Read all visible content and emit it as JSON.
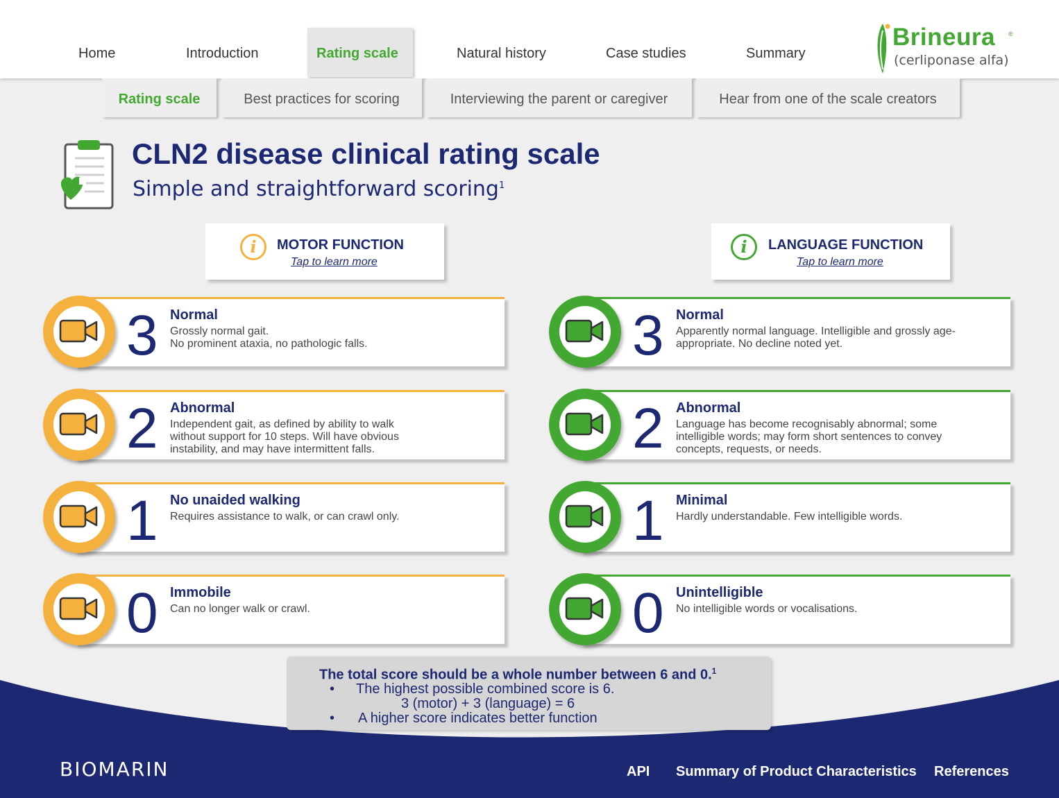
{
  "nav": {
    "items": [
      "Home",
      "Introduction",
      "Rating scale",
      "Natural history",
      "Case studies",
      "Summary"
    ],
    "active_index": 2
  },
  "logo": {
    "name": "Brineura",
    "reg": "®",
    "sub": "(cerliponase alfa)"
  },
  "subnav": {
    "items": [
      "Rating scale",
      "Best practices for scoring",
      "Interviewing the parent or caregiver",
      "Hear from one of the scale creators"
    ],
    "active_index": 0
  },
  "page": {
    "title": "CLN2 disease clinical rating scale",
    "subtitle": "Simple and straightforward scoring",
    "subtitle_ref": "1"
  },
  "motor": {
    "title": "MOTOR FUNCTION",
    "link": "Tap to learn more",
    "color": "#f5b13e",
    "rows": [
      {
        "score": "3",
        "title": "Normal",
        "desc": [
          "Grossly normal gait.",
          "No prominent ataxia, no pathologic falls."
        ]
      },
      {
        "score": "2",
        "title": "Abnormal",
        "desc": [
          "Independent gait, as defined by ability to walk",
          "without support for 10 steps. Will have obvious",
          "instability, and may have intermittent falls."
        ]
      },
      {
        "score": "1",
        "title": "No unaided walking",
        "desc": [
          "Requires assistance to walk, or can crawl only."
        ]
      },
      {
        "score": "0",
        "title": "Immobile",
        "desc": [
          "Can no longer walk or crawl."
        ]
      }
    ]
  },
  "language": {
    "title": "LANGUAGE FUNCTION",
    "link": "Tap to learn more",
    "color": "#43a832",
    "rows": [
      {
        "score": "3",
        "title": "Normal",
        "desc": [
          "Apparently normal language. Intelligible and grossly age-",
          "appropriate. No decline noted yet."
        ]
      },
      {
        "score": "2",
        "title": "Abnormal",
        "desc": [
          "Language has become recognisably abnormal; some",
          "intelligible words; may form short sentences to convey",
          "concepts, requests, or needs."
        ]
      },
      {
        "score": "1",
        "title": "Minimal",
        "desc": [
          "Hardly understandable. Few intelligible words."
        ]
      },
      {
        "score": "0",
        "title": "Unintelligible",
        "desc": [
          "No intelligible words or vocalisations."
        ]
      }
    ]
  },
  "total": {
    "heading": "The total score should be a whole number between 6 and 0.",
    "heading_ref": "1",
    "bullet1": "The highest possible combined score is 6.",
    "formula": "3 (motor) + 3 (language) = 6",
    "bullet2": "A higher score indicates better function"
  },
  "footer": {
    "brand": "BIOMARIN",
    "links": [
      "API",
      "Summary of Product Characteristics",
      "References"
    ]
  }
}
